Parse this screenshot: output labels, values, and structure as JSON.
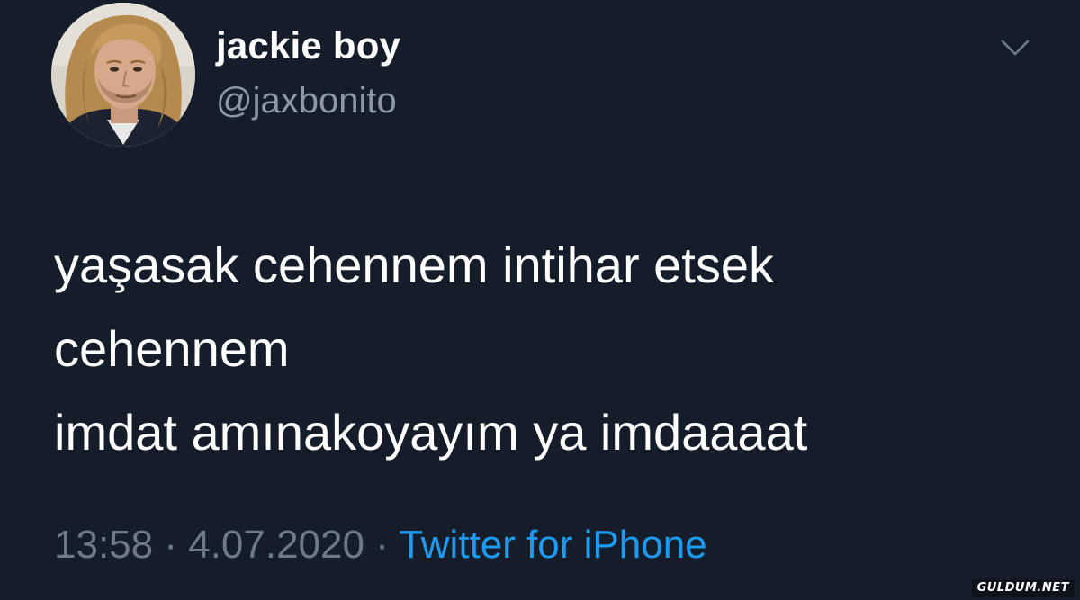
{
  "user": {
    "display_name": "jackie boy",
    "handle": "@jaxbonito",
    "avatar_icon": "profile-photo"
  },
  "menu": {
    "icon": "chevron-down-icon"
  },
  "tweet": {
    "lines": [
      "yaşasak cehennem intihar etsek",
      "cehennem",
      "imdat amınakoyayım ya imdaaaat"
    ]
  },
  "meta": {
    "time": "13:58",
    "separator_1": " · ",
    "date": "4.07.2020",
    "separator_2": " · ",
    "source": "Twitter for iPhone"
  },
  "watermark": {
    "text": "GULDUM.NET"
  },
  "colors": {
    "background": "#151d2a",
    "primary_text": "#ffffff",
    "secondary_text": "#8c98a6",
    "meta_text": "#6e7a88",
    "link": "#1d9bf0"
  }
}
